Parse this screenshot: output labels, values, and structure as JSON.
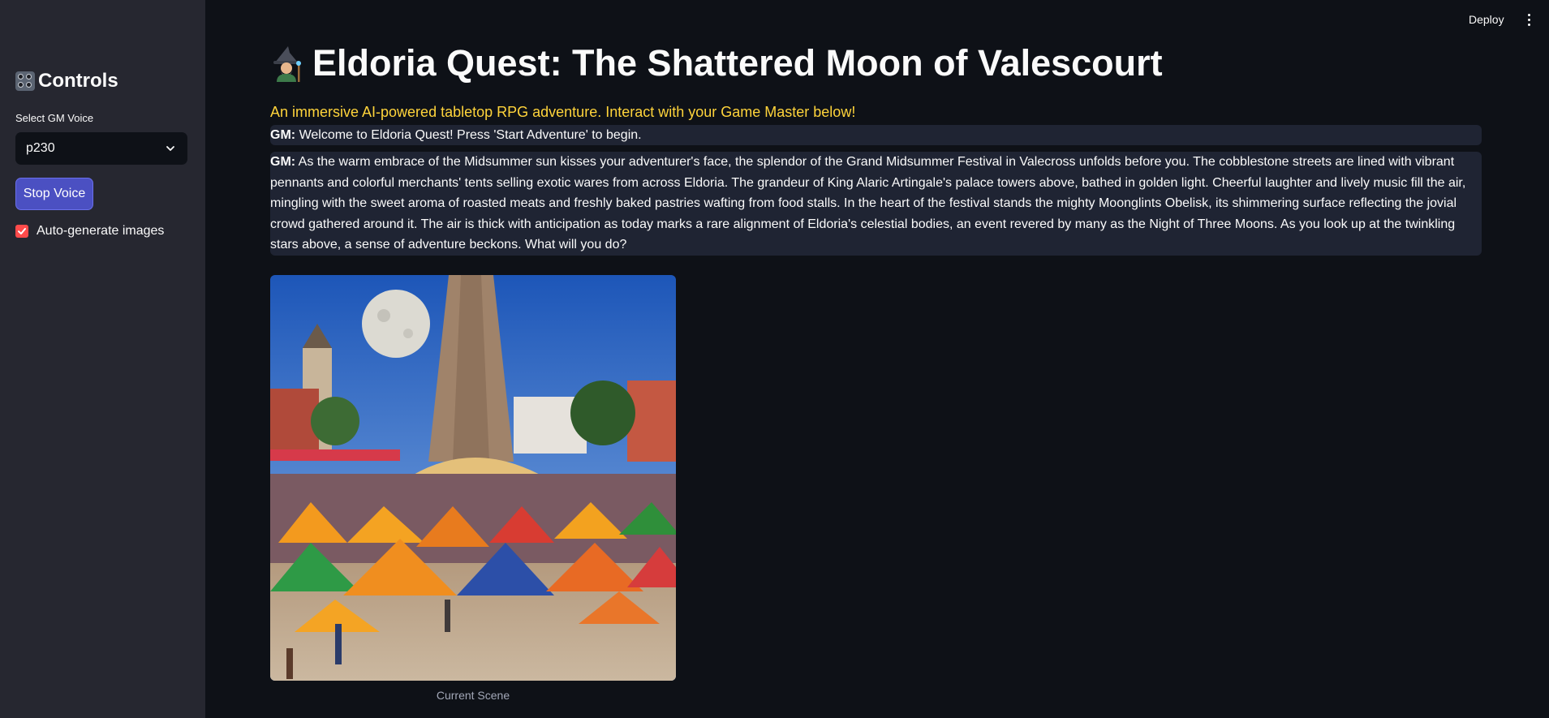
{
  "sidebar": {
    "title": "Controls",
    "title_icon": "control-knobs-icon",
    "voice_label": "Select GM Voice",
    "voice_selected": "p230",
    "stop_label": "Stop Voice",
    "autogen_label": "Auto-generate images",
    "autogen_checked": true
  },
  "topbar": {
    "deploy_label": "Deploy",
    "menu_icon": "kebab-menu-icon"
  },
  "main": {
    "title": "Eldoria Quest: The Shattered Moon of Valescourt",
    "title_icon": "mage-icon",
    "subtitle": "An immersive AI-powered tabletop RPG adventure. Interact with your Game Master below!",
    "messages": [
      {
        "speaker": "GM:",
        "text": "Welcome to Eldoria Quest! Press 'Start Adventure' to begin."
      },
      {
        "speaker": "GM:",
        "text": "As the warm embrace of the Midsummer sun kisses your adventurer's face, the splendor of the Grand Midsummer Festival in Valecross unfolds before you. The cobblestone streets are lined with vibrant pennants and colorful merchants' tents selling exotic wares from across Eldoria. The grandeur of King Alaric Artingale's palace towers above, bathed in golden light. Cheerful laughter and lively music fill the air, mingling with the sweet aroma of roasted meats and freshly baked pastries wafting from food stalls. In the heart of the festival stands the mighty Moonglints Obelisk, its shimmering surface reflecting the jovial crowd gathered around it. The air is thick with anticipation as today marks a rare alignment of Eldoria's celestial bodies, an event revered by many as the Night of Three Moons. As you look up at the twinkling stars above, a sense of adventure beckons. What will you do?"
      }
    ],
    "scene_caption": "Current Scene"
  },
  "colors": {
    "background": "#0e1117",
    "sidebar": "#262730",
    "accent_button": "#4b50c2",
    "subtitle": "#ffd43b",
    "checkbox": "#ff4b4b",
    "message_bg": "#1f2433"
  }
}
